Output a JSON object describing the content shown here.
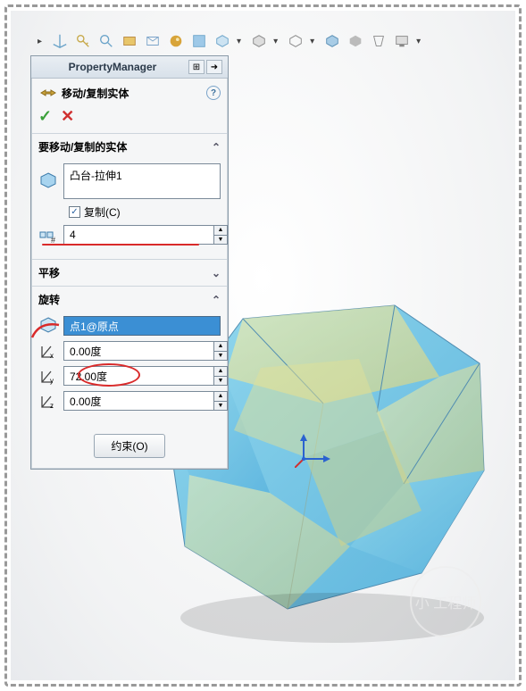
{
  "toolbar": {
    "icons": [
      "origin",
      "key",
      "zoom-fit",
      "section",
      "zone",
      "appearance",
      "scene",
      "view-cube",
      "render",
      "draft",
      "camera",
      "edges",
      "shadow",
      "perspective",
      "monitor"
    ]
  },
  "pm": {
    "title": "PropertyManager",
    "feature_title": "移动/复制实体",
    "help": "?",
    "ok": "✓",
    "cancel": "✕",
    "pin": "⊞",
    "arrow": "➜"
  },
  "sections": {
    "bodies": {
      "title": "要移动/复制的实体",
      "item": "凸台-拉伸1",
      "copy_label": "复制(C)",
      "copy_checked": "✓",
      "count": "4"
    },
    "translate": {
      "title": "平移",
      "chev": "⌄"
    },
    "rotate": {
      "title": "旋转",
      "chev": "⌃",
      "ref_item": "点1@原点",
      "x": "0.00度",
      "y": "72.00度",
      "z": "0.00度"
    }
  },
  "constraint_btn": "约束(O)",
  "watermark": "小 工程师"
}
